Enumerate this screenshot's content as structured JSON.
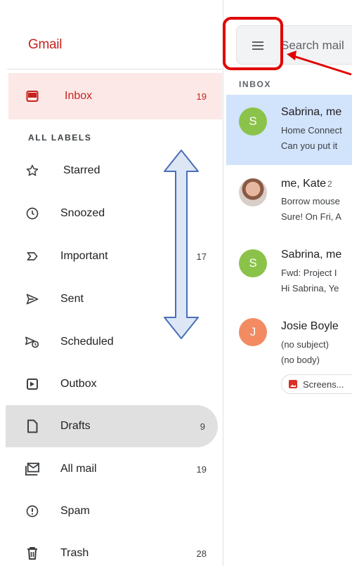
{
  "app": {
    "name": "Gmail"
  },
  "search": {
    "placeholder": "Search mail"
  },
  "nav": {
    "inbox": {
      "label": "Inbox",
      "count": "19"
    },
    "section_label": "ALL LABELS",
    "items": [
      {
        "label": "Starred",
        "count": ""
      },
      {
        "label": "Snoozed",
        "count": ""
      },
      {
        "label": "Important",
        "count": "17"
      },
      {
        "label": "Sent",
        "count": ""
      },
      {
        "label": "Scheduled",
        "count": ""
      },
      {
        "label": "Outbox",
        "count": ""
      },
      {
        "label": "Drafts",
        "count": "9"
      },
      {
        "label": "All mail",
        "count": "19"
      },
      {
        "label": "Spam",
        "count": ""
      },
      {
        "label": "Trash",
        "count": "28"
      }
    ]
  },
  "mail": {
    "section_title": "INBOX",
    "emails": [
      {
        "avatar": "S",
        "avatar_color": "#8bc34a",
        "sender": "Sabrina, me",
        "count": "",
        "subject": "Home Connect",
        "snippet": "Can you put it"
      },
      {
        "avatar": "",
        "avatar_color": "photo",
        "sender": "me, Kate",
        "count": "2",
        "subject": "Borrow mouse",
        "snippet": "Sure! On Fri, A"
      },
      {
        "avatar": "S",
        "avatar_color": "#8bc34a",
        "sender": "Sabrina, me",
        "count": "",
        "subject": "Fwd: Project I",
        "snippet": "Hi Sabrina, Ye"
      },
      {
        "avatar": "J",
        "avatar_color": "#f28b61",
        "sender": "Josie Boyle",
        "count": "",
        "subject": "(no subject)",
        "snippet": "(no body)",
        "attachment": "Screens..."
      }
    ]
  },
  "colors": {
    "brand_red": "#c5221f",
    "highlight_red": "#e00000",
    "selected_row": "#d2e3fc",
    "arrow_blue": "#4a6fb5"
  }
}
